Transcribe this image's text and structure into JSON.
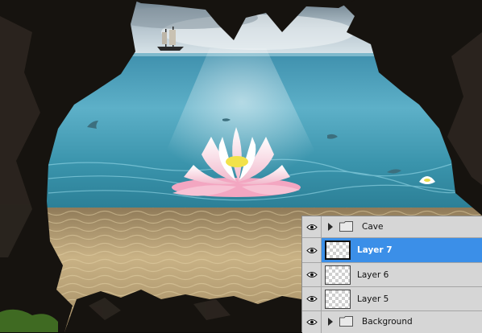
{
  "layers_panel": {
    "layers": [
      {
        "name": "Cave",
        "kind": "group",
        "selected": false,
        "visible": true
      },
      {
        "name": "Layer 7",
        "kind": "layer",
        "selected": true,
        "visible": true
      },
      {
        "name": "Layer 6",
        "kind": "layer",
        "selected": false,
        "visible": true
      },
      {
        "name": "Layer 5",
        "kind": "layer",
        "selected": false,
        "visible": true
      },
      {
        "name": "Background",
        "kind": "group",
        "selected": false,
        "visible": true
      }
    ],
    "icons": {
      "visibility": "eye-icon",
      "expand": "triangle-right-icon",
      "group": "folder-icon"
    }
  },
  "colors": {
    "selection": "#3b8fe8",
    "panel": "#d6d6d6"
  }
}
